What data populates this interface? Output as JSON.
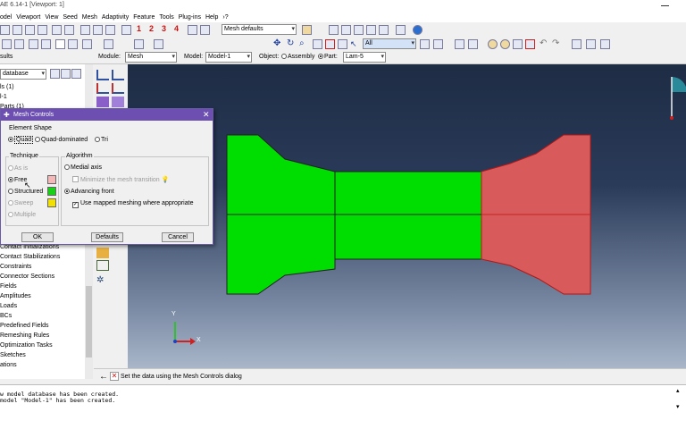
{
  "window": {
    "title": "AE 6.14-1 [Viewport: 1]"
  },
  "menu": [
    "odel",
    "Viewport",
    "View",
    "Seed",
    "Mesh",
    "Adaptivity",
    "Feature",
    "Tools",
    "Plug-ins",
    "Help",
    "›?"
  ],
  "toolbar": {
    "numbers": [
      "1",
      "2",
      "3",
      "4"
    ],
    "mesh_defaults": "Mesh defaults",
    "select_filter": "All"
  },
  "context": {
    "module_label": "Module:",
    "module_value": "Mesh",
    "model_label": "Model:",
    "model_value": "Model-1",
    "object_label": "Object:",
    "assembly_label": "Assembly",
    "part_label": "Part:",
    "part_value": "Lam-5"
  },
  "tree": {
    "header": "sults",
    "combo": "database",
    "items": [
      "ls (1)",
      "l-1",
      "Parts (1)",
      "Contact Initializations",
      "Contact Stabilizations",
      "Constraints",
      "Connector Sections",
      "Fields",
      "Amplitudes",
      "Loads",
      "BCs",
      "Predefined Fields",
      "Remeshing Rules",
      "Optimization Tasks",
      "Sketches",
      "ations"
    ]
  },
  "dialog": {
    "title": "Mesh Controls",
    "element_shape_label": "Element Shape",
    "shape_options": [
      "Quad",
      "Quad-dominated",
      "Tri"
    ],
    "technique_label": "Technique",
    "techniques": [
      "As is",
      "Free",
      "Structured",
      "Sweep",
      "Multiple"
    ],
    "algorithm_label": "Algorithm",
    "algorithms": [
      "Medial axis",
      "Advancing front"
    ],
    "minimize_label": "Minimize the mesh transition",
    "mapped_label": "Use mapped meshing where appropriate",
    "ok": "OK",
    "defaults": "Defaults",
    "cancel": "Cancel",
    "swatch_colors": {
      "free": "#f4b8b8",
      "structured": "#18d018",
      "sweep": "#f2e000"
    }
  },
  "viewport": {
    "axis_y": "Y",
    "axis_x": "X",
    "colors": {
      "structured": "#00dd00",
      "free": "#d85a5a",
      "edge": "#cc2020"
    }
  },
  "prompt": "Set the data using the Mesh Controls dialog",
  "messages": [
    "w model database has been created.",
    "model \"Model-1\" has been created."
  ]
}
